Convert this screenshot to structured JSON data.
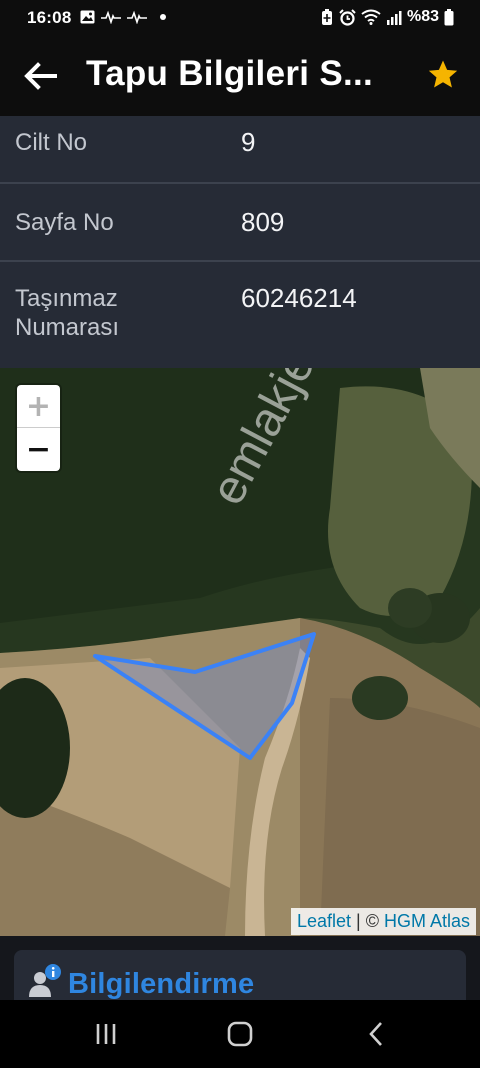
{
  "status_bar": {
    "time": "16:08",
    "battery": "%83",
    "icons": [
      "image-icon",
      "heartbeat-icon",
      "dot-icon",
      "battery-saver-icon",
      "alarm-icon",
      "wifi-icon",
      "signal-icon",
      "battery-icon"
    ]
  },
  "app_bar": {
    "title": "Tapu Bilgileri S...",
    "back_icon": "arrow-left-icon",
    "favorite_icon": "star-icon",
    "star_color": "#f5b400"
  },
  "info": {
    "rows": [
      {
        "label": "Cilt No",
        "value": "9"
      },
      {
        "label": "Sayfa No",
        "value": "809"
      },
      {
        "label": "Taşınmaz Numarası",
        "value": "60246214"
      }
    ]
  },
  "map": {
    "zoom_in": "+",
    "zoom_out": "−",
    "watermark": "emlakjet.com",
    "attribution_leaflet": "Leaflet",
    "attribution_sep": " | © ",
    "attribution_source": "HGM Atlas",
    "parcel_color": "#3b82f6"
  },
  "panel": {
    "title": "Bilgilendirme",
    "icon": "user-info-icon",
    "accent": "#2f86e0"
  },
  "nav": {
    "icons": [
      "recent-apps-icon",
      "home-icon",
      "back-nav-icon"
    ]
  }
}
